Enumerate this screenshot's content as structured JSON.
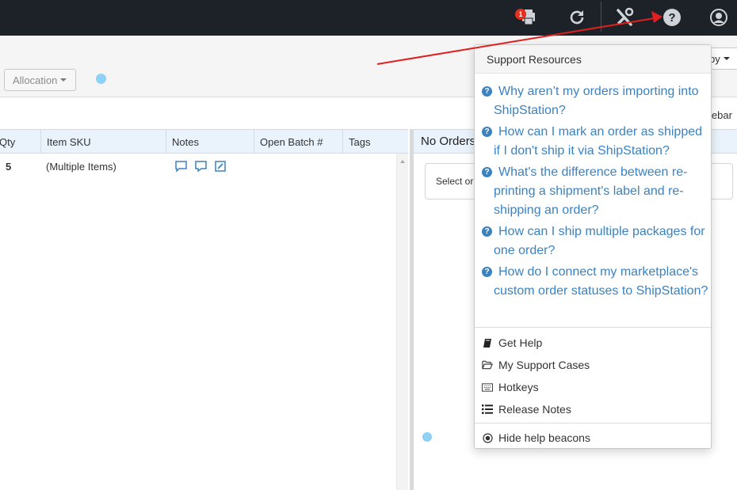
{
  "topbar": {
    "notification_count": "1",
    "icons": [
      "printer-icon",
      "refresh-icon",
      "tools-icon",
      "help-icon",
      "user-icon"
    ]
  },
  "toolbar": {
    "allocation_label": "Allocation",
    "group_by_label": "by",
    "sidebar_label": "lebar"
  },
  "table": {
    "columns": [
      "Qty",
      "Item SKU",
      "Notes",
      "Open Batch #",
      "Tags"
    ],
    "rows": [
      {
        "qty": "5",
        "sku": "(Multiple Items)"
      }
    ]
  },
  "right_panel": {
    "title": "No Orders",
    "select_prompt": "Select or"
  },
  "support_menu": {
    "header": "Support Resources",
    "faqs": [
      {
        "text": "Why aren’t my orders importing into ShipStation?"
      },
      {
        "text": "How can I mark an order as shipped if I don't ship it via ShipStation?"
      },
      {
        "text": "What's the difference between re-printing a shipment's label and re-shipping an order?"
      },
      {
        "text": "How can I ship multiple packages for one order?"
      },
      {
        "text": "How do I connect my marketplace's custom order statuses to ShipStation?"
      }
    ],
    "items": [
      {
        "label": "Get Help",
        "icon": "book-icon"
      },
      {
        "label": "My Support Cases",
        "icon": "folder-open-icon"
      },
      {
        "label": "Hotkeys",
        "icon": "keyboard-icon"
      },
      {
        "label": "Release Notes",
        "icon": "list-icon"
      }
    ],
    "beacons_item": {
      "label": "Hide help beacons",
      "icon": "beacon-icon"
    }
  },
  "colors": {
    "topbar": "#1d2228",
    "link": "#3b82c1",
    "highlight": "#ffff00",
    "arrow": "#e02020",
    "beacon": "#8fd0f5"
  }
}
